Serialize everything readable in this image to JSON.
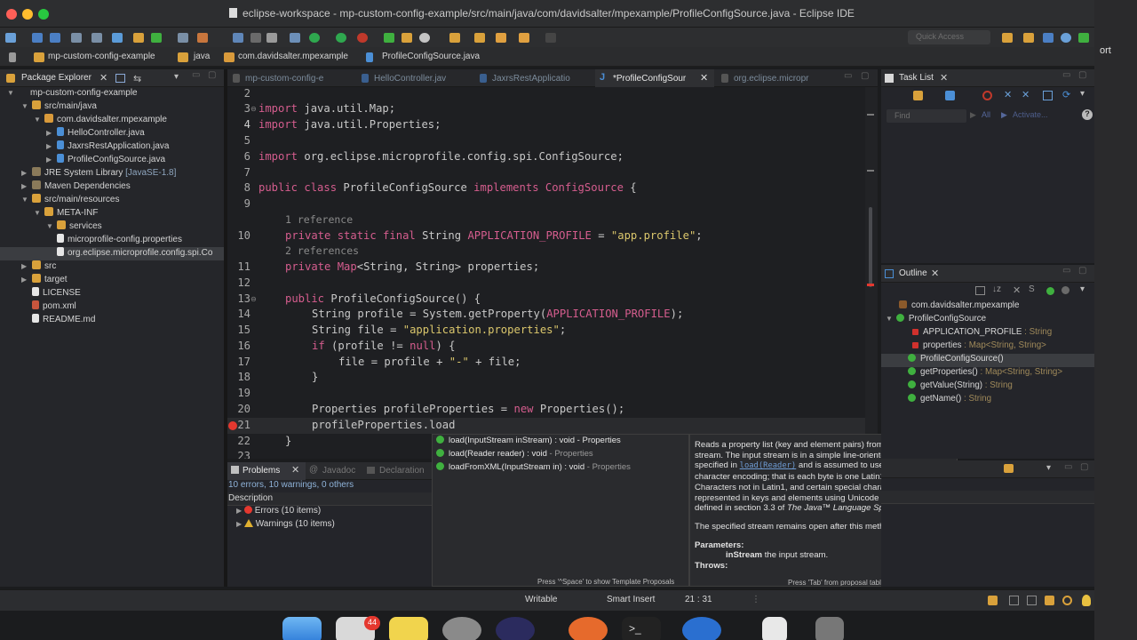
{
  "window": {
    "title": "eclipse-workspace - mp-custom-config-example/src/main/java/com/davidsalter/mpexample/ProfileConfigSource.java - Eclipse IDE",
    "edge_text": "ort"
  },
  "toolbar": {
    "quick_access": "Quick Access"
  },
  "breadcrumb": {
    "items": [
      "mp-custom-config-example",
      "java",
      "com.davidsalter.mpexample",
      "ProfileConfigSource.java"
    ]
  },
  "package_explorer": {
    "title": "Package Explorer",
    "tree": [
      {
        "label": "mp-custom-config-example",
        "depth": 0
      },
      {
        "label": "src/main/java",
        "depth": 1
      },
      {
        "label": "com.davidsalter.mpexample",
        "depth": 2
      },
      {
        "label": "HelloController.java",
        "depth": 3
      },
      {
        "label": "JaxrsRestApplication.java",
        "depth": 3
      },
      {
        "label": "ProfileConfigSource.java",
        "depth": 3
      },
      {
        "label": "JRE System Library",
        "suffix": "[JavaSE-1.8]",
        "depth": 1
      },
      {
        "label": "Maven Dependencies",
        "depth": 1
      },
      {
        "label": "src/main/resources",
        "depth": 1
      },
      {
        "label": "META-INF",
        "depth": 2
      },
      {
        "label": "services",
        "depth": 3
      },
      {
        "label": "microprofile-config.properties",
        "depth": 3
      },
      {
        "label": "org.eclipse.microprofile.config.spi.Co",
        "depth": 3
      },
      {
        "label": "src",
        "depth": 1
      },
      {
        "label": "target",
        "depth": 1
      },
      {
        "label": "LICENSE",
        "depth": 1
      },
      {
        "label": "pom.xml",
        "depth": 1
      },
      {
        "label": "README.md",
        "depth": 1
      }
    ]
  },
  "editor_tabs": [
    "mp-custom-config-e",
    "HelloController.jav",
    "JaxrsRestApplicatio",
    "*ProfileConfigSour",
    "org.eclipse.micropr"
  ],
  "code": {
    "line_numbers": [
      "2",
      "3",
      "4",
      "5",
      "6",
      "7",
      "8",
      "9",
      "10",
      "11",
      "12",
      "13",
      "14",
      "15",
      "16",
      "17",
      "18",
      "19",
      "20",
      "21",
      "22",
      "23"
    ],
    "ref1": "1 reference",
    "ref2": "2 references",
    "l3a": "import",
    "l3b": " java.util.Map;",
    "l4a": "import",
    "l4b": " java.util.Properties;",
    "l6a": "import",
    "l6b": " org.eclipse.microprofile.config.spi.ConfigSource;",
    "l8a": "public class",
    "l8b": " ProfileConfigSource ",
    "l8c": "implements",
    "l8d": " ConfigSource",
    "l8e": " {",
    "l10a": "private static final",
    "l10b": " String ",
    "l10c": "APPLICATION_PROFILE",
    "l10d": " = ",
    "l10e": "\"app.profile\"",
    "l10f": ";",
    "l11a": "private",
    "l11b": " Map",
    "l11c": "<String, String> ",
    "l11d": "properties",
    "l11e": ";",
    "l13a": "public",
    "l13b": " ProfileConfigSource",
    "l13c": "() {",
    "l14a": "String ",
    "l14b": "profile",
    "l14c": " = System.",
    "l14d": "getProperty",
    "l14e": "(",
    "l14f": "APPLICATION_PROFILE",
    "l14g": ");",
    "l15a": "String ",
    "l15b": "file",
    "l15c": " = ",
    "l15d": "\"application.properties\"",
    "l15e": ";",
    "l16a": "if",
    "l16b": " (",
    "l16c": "profile",
    "l16d": " != ",
    "l16e": "null",
    "l16f": ") {",
    "l17a": "file",
    "l17b": " = ",
    "l17c": "profile",
    "l17d": " + ",
    "l17e": "\"-\"",
    "l17f": " + ",
    "l17g": "file",
    "l17h": ";",
    "l18": "}",
    "l20a": "Properties ",
    "l20b": "profileProperties",
    "l20c": " = ",
    "l20d": "new",
    "l20e": " Properties();",
    "l21": "profileProperties.load",
    "l22": "}"
  },
  "content_assist": {
    "items": [
      {
        "name": "load(InputStream inStream) : void",
        "owner": " - Properties"
      },
      {
        "name": "load(Reader reader) : void",
        "owner": " - Properties"
      },
      {
        "name": "loadFromXML(InputStream in) : void",
        "owner": " - Properties"
      }
    ],
    "hint": "Press '^Space' to show Template Proposals"
  },
  "javadoc": {
    "p1a": "Reads a property list (key and element pairs) from the input byte stream. The input stream is in a simple line-oriented format as specified in ",
    "p1link": "load(Reader)",
    "p1b": " and is assumed to use the ISO 8859-1 character encoding; that is each byte is one Latin1 character. Characters not in Latin1, and certain special characters, are represented in keys and elements using Unicode escapes as defined in section 3.3 of ",
    "p1c": "The Java™ Language Specification",
    "p1d": ".",
    "p2": "The specified stream remains open after this method returns.",
    "params_label": "Parameters:",
    "param_name": "inStream",
    "param_desc": " the input stream.",
    "throws_label": "Throws:",
    "hint": "Press 'Tab' from proposal table or click for focus"
  },
  "bottom_panel": {
    "tabs": [
      "Problems",
      "Javadoc",
      "Declaration"
    ],
    "summary": "10 errors, 10 warnings, 0 others",
    "column": "Description",
    "errors": "Errors (10 items)",
    "warnings": "Warnings (10 items)"
  },
  "task_list": {
    "title": "Task List",
    "find_placeholder": "Find",
    "all": "All",
    "activate": "Activate..."
  },
  "outline": {
    "title": "Outline",
    "items": [
      {
        "name": "com.davidsalter.mpexample",
        "type": "",
        "color": "#8b5a2b"
      },
      {
        "name": "ProfileConfigSource",
        "type": "",
        "color": "#3fb03f"
      },
      {
        "name": "APPLICATION_PROFILE",
        "type": " : String",
        "color": "#d0312d"
      },
      {
        "name": "properties",
        "type": " : Map<String, String>",
        "color": "#d0312d"
      },
      {
        "name": "ProfileConfigSource()",
        "type": "",
        "color": "#3fb03f"
      },
      {
        "name": "getProperties()",
        "type": " : Map<String, String>",
        "color": "#3fb03f"
      },
      {
        "name": "getValue(String)",
        "type": " : String",
        "color": "#3fb03f"
      },
      {
        "name": "getName()",
        "type": " : String",
        "color": "#3fb03f"
      }
    ]
  },
  "status": {
    "writable": "Writable",
    "insert_mode": "Smart Insert",
    "position": "21 : 31"
  },
  "dock": {
    "badge": "44"
  },
  "colors": {
    "accent": "#4b8fd6",
    "keyword": "#d55d8e",
    "string": "#dbc76c",
    "error": "#e5382f"
  }
}
